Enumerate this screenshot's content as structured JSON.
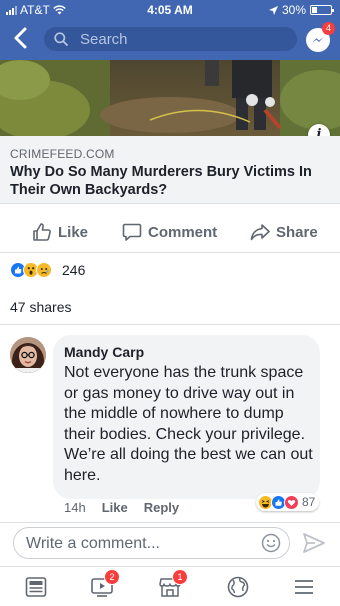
{
  "status_bar": {
    "carrier": "AT&T",
    "time": "4:05 AM",
    "battery": "30%",
    "battery_level": 0.3
  },
  "header": {
    "search_placeholder": "Search",
    "messenger_badge": "4",
    "icons": [
      "back-chevron-icon",
      "search-icon",
      "messenger-icon"
    ]
  },
  "link_preview": {
    "domain": "CRIMEFEED.COM",
    "headline": "Why Do So Many Murderers Bury Victims In Their Own Backyards?"
  },
  "actions": {
    "like": "Like",
    "comment": "Comment",
    "share": "Share"
  },
  "post_stats": {
    "reaction_count": "246",
    "shares": "47 shares"
  },
  "comment": {
    "author": "Mandy Carp",
    "text": "Not everyone has the trunk space or gas money to drive way out in the middle of nowhere to dump their bodies. Check your privilege. We’re all doing the best we can out here.",
    "time": "14h",
    "like": "Like",
    "reply": "Reply",
    "reaction_count": "87"
  },
  "composer": {
    "placeholder": "Write a comment..."
  },
  "tab_bar": {
    "video_badge": "2",
    "marketplace_badge": "1"
  },
  "colors": {
    "brand": "#4267b2",
    "badge": "#fa3e3e",
    "like_blue": "#1877f2",
    "muted_text": "#606770"
  }
}
